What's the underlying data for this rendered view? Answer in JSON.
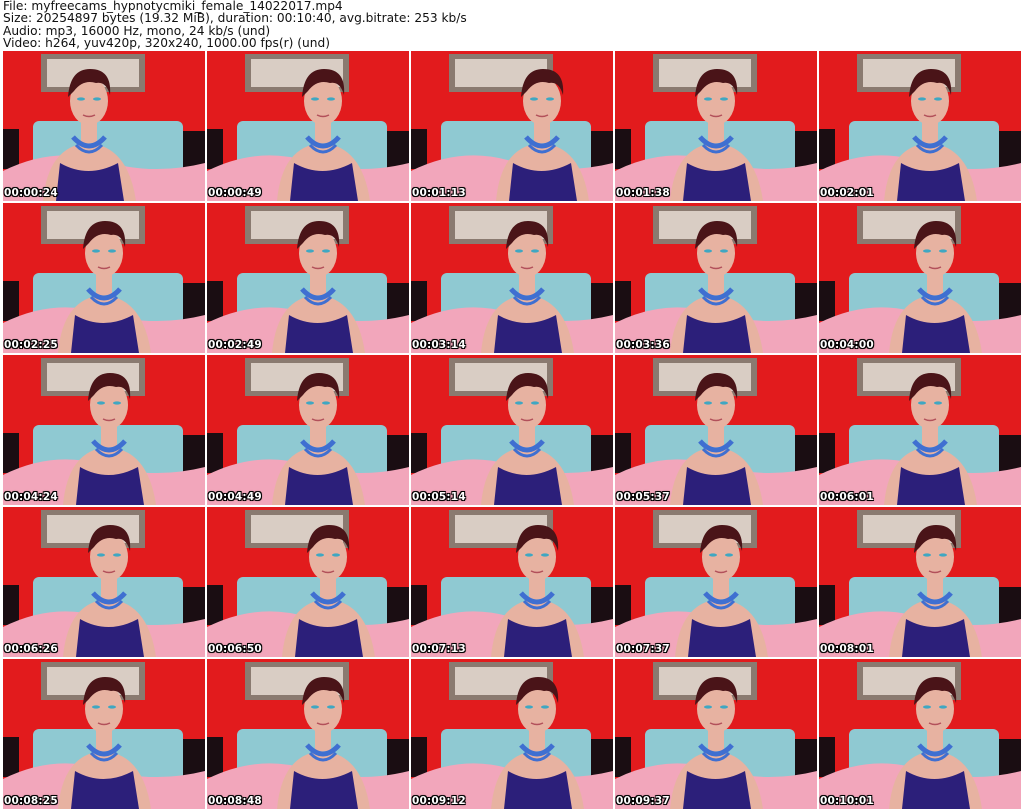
{
  "header": {
    "file_line": "File: myfreecams_hypnotycmiki_female_14022017.mp4",
    "size_line": "Size: 20254897 bytes (19.32 MiB), duration: 00:10:40, avg.bitrate: 253 kb/s",
    "audio_line": "Audio: mp3, 16000 Hz, mono, 24 kb/s (und)",
    "video_line": "Video: h264, yuv420p, 320x240, 1000.00 fps(r) (und)"
  },
  "colors": {
    "wall": "#e21b1d",
    "frame": "#8a7a70",
    "mirror": "#d9cdc4",
    "headboard": "#8fc9d2",
    "bed": "#f2a6bb",
    "skin": "#e7b2a1",
    "hair": "#4a1418",
    "top": "#2c1f7a",
    "necklace": "#3f6fd1"
  },
  "thumbnails": [
    {
      "timestamp": "00:00:24"
    },
    {
      "timestamp": "00:00:49"
    },
    {
      "timestamp": "00:01:13"
    },
    {
      "timestamp": "00:01:38"
    },
    {
      "timestamp": "00:02:01"
    },
    {
      "timestamp": "00:02:25"
    },
    {
      "timestamp": "00:02:49"
    },
    {
      "timestamp": "00:03:14"
    },
    {
      "timestamp": "00:03:36"
    },
    {
      "timestamp": "00:04:00"
    },
    {
      "timestamp": "00:04:24"
    },
    {
      "timestamp": "00:04:49"
    },
    {
      "timestamp": "00:05:14"
    },
    {
      "timestamp": "00:05:37"
    },
    {
      "timestamp": "00:06:01"
    },
    {
      "timestamp": "00:06:26"
    },
    {
      "timestamp": "00:06:50"
    },
    {
      "timestamp": "00:07:13"
    },
    {
      "timestamp": "00:07:37"
    },
    {
      "timestamp": "00:08:01"
    },
    {
      "timestamp": "00:08:25"
    },
    {
      "timestamp": "00:08:48"
    },
    {
      "timestamp": "00:09:12"
    },
    {
      "timestamp": "00:09:37"
    },
    {
      "timestamp": "00:10:01"
    }
  ]
}
